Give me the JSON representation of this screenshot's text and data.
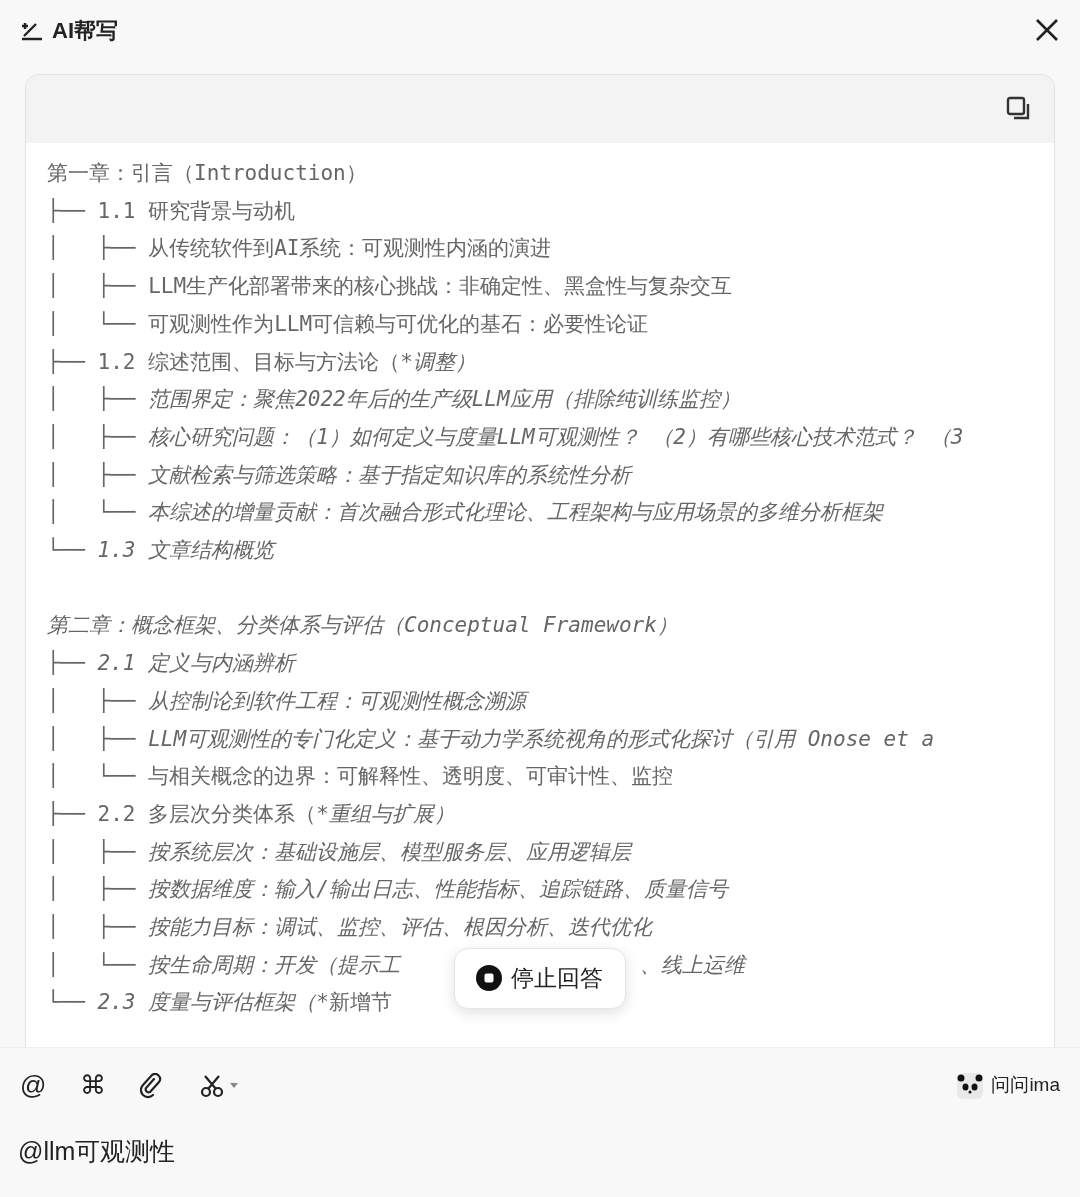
{
  "window": {
    "title": "AI帮写"
  },
  "outline": [
    {
      "parts": [
        {
          "text": "第一章：引言（Introduction）",
          "italic": false
        }
      ]
    },
    {
      "prefix": "├── ",
      "parts": [
        {
          "text": "1.1 研究背景与动机",
          "italic": false
        }
      ]
    },
    {
      "prefix": "│   ├── ",
      "parts": [
        {
          "text": "从传统软件到AI系统：可观测性内涵的演进",
          "italic": false
        }
      ]
    },
    {
      "prefix": "│   ├── ",
      "parts": [
        {
          "text": "LLM生产化部署带来的核心挑战：非确定性、黑盒性与复杂交互",
          "italic": false
        }
      ]
    },
    {
      "prefix": "│   └── ",
      "parts": [
        {
          "text": "可观测性作为LLM可信赖与可优化的基石：必要性论证",
          "italic": false
        }
      ]
    },
    {
      "prefix": "├── ",
      "parts": [
        {
          "text": "1.2 综述范围、目标与方法论（",
          "italic": false
        },
        {
          "text": "*调整）",
          "italic": true
        }
      ]
    },
    {
      "prefix": "│   ├── ",
      "parts": [
        {
          "text": "范围界定：聚焦2022年后的生产级LLM应用（排除纯训练监控）",
          "italic": true
        }
      ]
    },
    {
      "prefix": "│   ├── ",
      "parts": [
        {
          "text": "核心研究问题：（1）如何定义与度量LLM可观测性？ （2）有哪些核心技术范式？ （3",
          "italic": true
        }
      ]
    },
    {
      "prefix": "│   ├── ",
      "parts": [
        {
          "text": "文献检索与筛选策略：基于指定知识库的系统性分析",
          "italic": true
        }
      ]
    },
    {
      "prefix": "│   └── ",
      "parts": [
        {
          "text": "本综述的增量贡献：首次融合形式化理论、工程架构与应用场景的多维分析框架",
          "italic": true
        }
      ]
    },
    {
      "prefix": "└── ",
      "parts": [
        {
          "text": "1.3 文章结构概览",
          "italic": true
        }
      ]
    },
    {
      "kind": "blank"
    },
    {
      "parts": [
        {
          "text": "第二章：概念框架、分类体系与评估（Conceptual Framework）",
          "italic": true
        }
      ]
    },
    {
      "prefix": "├── ",
      "parts": [
        {
          "text": "2.1 定义与内涵辨析",
          "italic": true
        }
      ]
    },
    {
      "prefix": "│   ├── ",
      "parts": [
        {
          "text": "从控制论到软件工程：可观测性概念溯源",
          "italic": true
        }
      ]
    },
    {
      "prefix": "│   ├── ",
      "parts": [
        {
          "text": "LLM可观测性的专门化定义：基于动力学系统视角的形式化探讨（引用 Onose et a",
          "italic": true
        }
      ]
    },
    {
      "prefix": "│   └── ",
      "parts": [
        {
          "text": "与相关概念的边界：可解释性、透明度、可审计性、监控",
          "italic": false
        }
      ]
    },
    {
      "prefix": "├── ",
      "parts": [
        {
          "text": "2.2 多层次分类体系（",
          "italic": false
        },
        {
          "text": "*重组与扩展）",
          "italic": true
        }
      ]
    },
    {
      "prefix": "│   ├── ",
      "parts": [
        {
          "text": "按系统层次：基础设施层、模型服务层、应用逻辑层",
          "italic": true
        }
      ]
    },
    {
      "prefix": "│   ├── ",
      "parts": [
        {
          "text": "按数据维度：输入/输出日志、性能指标、追踪链路、质量信号",
          "italic": true
        }
      ]
    },
    {
      "prefix": "│   ├── ",
      "parts": [
        {
          "text": "按能力目标：调试、监控、评估、根因分析、迭代优化",
          "italic": true
        }
      ]
    },
    {
      "prefix": "│   └── ",
      "parts": [
        {
          "text": "按生命周期：开发（提示工",
          "italic": true
        },
        {
          "kind": "covered"
        },
        {
          "text": "、线上运维",
          "italic": true
        }
      ]
    },
    {
      "prefix": "└── ",
      "parts": [
        {
          "text": "2.3 度量与评估框架（*",
          "italic": true
        },
        {
          "text": "新增节",
          "italic": false
        }
      ]
    }
  ],
  "stop_button": {
    "label": "停止回答"
  },
  "toolbar": [
    {
      "kind": "text",
      "label": "@"
    },
    {
      "kind": "text",
      "label": "⌘"
    },
    {
      "kind": "link"
    },
    {
      "kind": "scissors"
    }
  ],
  "assistant": {
    "label": "问问ima"
  },
  "input": {
    "value": "@llm可观测性"
  }
}
